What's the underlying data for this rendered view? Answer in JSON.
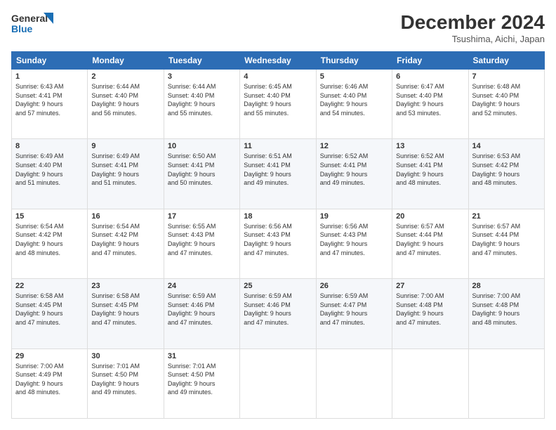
{
  "logo": {
    "line1": "General",
    "line2": "Blue"
  },
  "header": {
    "month": "December 2024",
    "location": "Tsushima, Aichi, Japan"
  },
  "weekdays": [
    "Sunday",
    "Monday",
    "Tuesday",
    "Wednesday",
    "Thursday",
    "Friday",
    "Saturday"
  ],
  "weeks": [
    [
      {
        "day": "1",
        "info": "Sunrise: 6:43 AM\nSunset: 4:41 PM\nDaylight: 9 hours\nand 57 minutes."
      },
      {
        "day": "2",
        "info": "Sunrise: 6:44 AM\nSunset: 4:40 PM\nDaylight: 9 hours\nand 56 minutes."
      },
      {
        "day": "3",
        "info": "Sunrise: 6:44 AM\nSunset: 4:40 PM\nDaylight: 9 hours\nand 55 minutes."
      },
      {
        "day": "4",
        "info": "Sunrise: 6:45 AM\nSunset: 4:40 PM\nDaylight: 9 hours\nand 55 minutes."
      },
      {
        "day": "5",
        "info": "Sunrise: 6:46 AM\nSunset: 4:40 PM\nDaylight: 9 hours\nand 54 minutes."
      },
      {
        "day": "6",
        "info": "Sunrise: 6:47 AM\nSunset: 4:40 PM\nDaylight: 9 hours\nand 53 minutes."
      },
      {
        "day": "7",
        "info": "Sunrise: 6:48 AM\nSunset: 4:40 PM\nDaylight: 9 hours\nand 52 minutes."
      }
    ],
    [
      {
        "day": "8",
        "info": "Sunrise: 6:49 AM\nSunset: 4:40 PM\nDaylight: 9 hours\nand 51 minutes."
      },
      {
        "day": "9",
        "info": "Sunrise: 6:49 AM\nSunset: 4:41 PM\nDaylight: 9 hours\nand 51 minutes."
      },
      {
        "day": "10",
        "info": "Sunrise: 6:50 AM\nSunset: 4:41 PM\nDaylight: 9 hours\nand 50 minutes."
      },
      {
        "day": "11",
        "info": "Sunrise: 6:51 AM\nSunset: 4:41 PM\nDaylight: 9 hours\nand 49 minutes."
      },
      {
        "day": "12",
        "info": "Sunrise: 6:52 AM\nSunset: 4:41 PM\nDaylight: 9 hours\nand 49 minutes."
      },
      {
        "day": "13",
        "info": "Sunrise: 6:52 AM\nSunset: 4:41 PM\nDaylight: 9 hours\nand 48 minutes."
      },
      {
        "day": "14",
        "info": "Sunrise: 6:53 AM\nSunset: 4:42 PM\nDaylight: 9 hours\nand 48 minutes."
      }
    ],
    [
      {
        "day": "15",
        "info": "Sunrise: 6:54 AM\nSunset: 4:42 PM\nDaylight: 9 hours\nand 48 minutes."
      },
      {
        "day": "16",
        "info": "Sunrise: 6:54 AM\nSunset: 4:42 PM\nDaylight: 9 hours\nand 47 minutes."
      },
      {
        "day": "17",
        "info": "Sunrise: 6:55 AM\nSunset: 4:43 PM\nDaylight: 9 hours\nand 47 minutes."
      },
      {
        "day": "18",
        "info": "Sunrise: 6:56 AM\nSunset: 4:43 PM\nDaylight: 9 hours\nand 47 minutes."
      },
      {
        "day": "19",
        "info": "Sunrise: 6:56 AM\nSunset: 4:43 PM\nDaylight: 9 hours\nand 47 minutes."
      },
      {
        "day": "20",
        "info": "Sunrise: 6:57 AM\nSunset: 4:44 PM\nDaylight: 9 hours\nand 47 minutes."
      },
      {
        "day": "21",
        "info": "Sunrise: 6:57 AM\nSunset: 4:44 PM\nDaylight: 9 hours\nand 47 minutes."
      }
    ],
    [
      {
        "day": "22",
        "info": "Sunrise: 6:58 AM\nSunset: 4:45 PM\nDaylight: 9 hours\nand 47 minutes."
      },
      {
        "day": "23",
        "info": "Sunrise: 6:58 AM\nSunset: 4:45 PM\nDaylight: 9 hours\nand 47 minutes."
      },
      {
        "day": "24",
        "info": "Sunrise: 6:59 AM\nSunset: 4:46 PM\nDaylight: 9 hours\nand 47 minutes."
      },
      {
        "day": "25",
        "info": "Sunrise: 6:59 AM\nSunset: 4:46 PM\nDaylight: 9 hours\nand 47 minutes."
      },
      {
        "day": "26",
        "info": "Sunrise: 6:59 AM\nSunset: 4:47 PM\nDaylight: 9 hours\nand 47 minutes."
      },
      {
        "day": "27",
        "info": "Sunrise: 7:00 AM\nSunset: 4:48 PM\nDaylight: 9 hours\nand 47 minutes."
      },
      {
        "day": "28",
        "info": "Sunrise: 7:00 AM\nSunset: 4:48 PM\nDaylight: 9 hours\nand 48 minutes."
      }
    ],
    [
      {
        "day": "29",
        "info": "Sunrise: 7:00 AM\nSunset: 4:49 PM\nDaylight: 9 hours\nand 48 minutes."
      },
      {
        "day": "30",
        "info": "Sunrise: 7:01 AM\nSunset: 4:50 PM\nDaylight: 9 hours\nand 49 minutes."
      },
      {
        "day": "31",
        "info": "Sunrise: 7:01 AM\nSunset: 4:50 PM\nDaylight: 9 hours\nand 49 minutes."
      },
      null,
      null,
      null,
      null
    ]
  ]
}
